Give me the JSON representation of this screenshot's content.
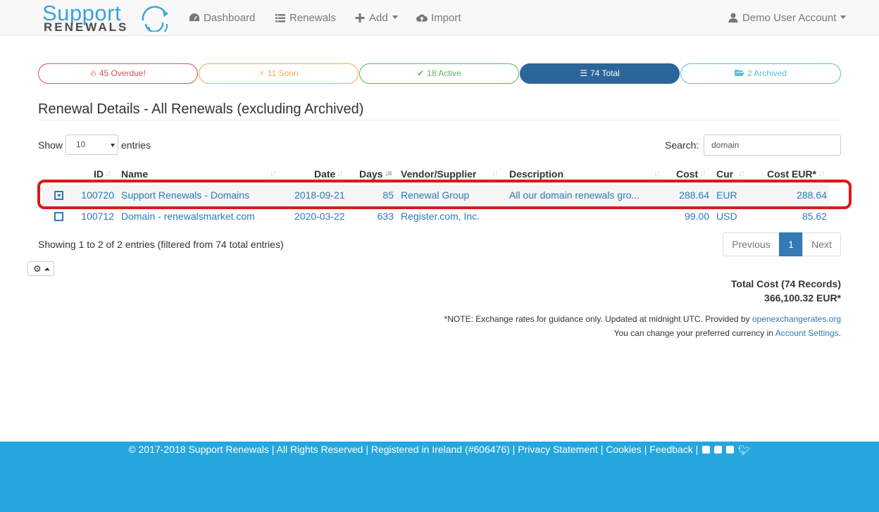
{
  "brand": {
    "line1": "Support",
    "line2": "RENEWALS"
  },
  "nav": {
    "dashboard": "Dashboard",
    "renewals": "Renewals",
    "add": "Add",
    "import": "Import",
    "account": "Demo User Account"
  },
  "status_pills": [
    {
      "label": "45 Overdue!",
      "color": "#d9534f",
      "icon": "fire-icon"
    },
    {
      "label": "11 Soon",
      "color": "#f0ad4e",
      "icon": "bolt-icon"
    },
    {
      "label": "18 Active",
      "color": "#5cb85c",
      "icon": "check-icon"
    },
    {
      "label": "74 Total",
      "color": "#2c6599",
      "icon": "list-icon"
    },
    {
      "label": "2 Archived",
      "color": "#5bc0de",
      "icon": "folder-open-icon"
    }
  ],
  "page_title": "Renewal Details - All Renewals (excluding Archived)",
  "length": {
    "show": "Show",
    "value": "10",
    "entries": "entries"
  },
  "search": {
    "label": "Search:",
    "value": "domain"
  },
  "table": {
    "columns": [
      "ID",
      "Name",
      "Date",
      "Days",
      "Vendor/Supplier",
      "Description",
      "Cost",
      "Cur",
      "Cost EUR*"
    ],
    "rows": [
      {
        "id": "100720",
        "name": "Support Renewals - Domains",
        "date": "2018-09-21",
        "days": "85",
        "vendor": "Renewal Group",
        "description": "All our domain renewals gro...",
        "cost": "288.64",
        "cur": "EUR",
        "cost_eur": "288.64"
      },
      {
        "id": "100712",
        "name": "Domain - renewalsmarket.com",
        "date": "2020-03-22",
        "days": "633",
        "vendor": "Register.com, Inc.",
        "description": "",
        "cost": "99.00",
        "cur": "USD",
        "cost_eur": "85.62"
      }
    ]
  },
  "info": "Showing 1 to 2 of 2 entries (filtered from 74 total entries)",
  "pagination": {
    "previous": "Previous",
    "current": "1",
    "next": "Next"
  },
  "totals": {
    "label": "Total Cost (74 Records)",
    "value": "366,100.32 EUR*"
  },
  "note": {
    "line1_text": "*NOTE: Exchange rates for guidance only. Updated at midnight UTC. Provided by",
    "line1_link": "openexchangerates.org",
    "line2_text": "You can change your preferred currency in",
    "line2_link": "Account Settings",
    "line2_end": "."
  },
  "footer": {
    "copyright": "2017-2018 Support Renewals | All Rights Reserved | Registered in Ireland (#606476) |",
    "privacy": "Privacy Statement",
    "cookies": "Cookies",
    "feedback": "Feedback",
    "sep": "|"
  },
  "colors": {
    "link": "#2a7ab8",
    "highlight": "#e0161c",
    "footer": "#26a6df",
    "primary": "#337ab7"
  }
}
